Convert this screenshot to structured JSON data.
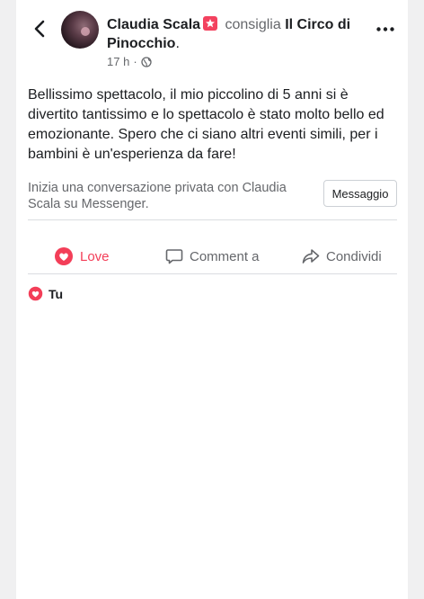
{
  "post": {
    "author": "Claudia Scala",
    "recommends_label": "consiglia",
    "page_name": "Il Circo di Pinocchio",
    "time": "17 h",
    "time_separator": "·",
    "body": "Bellissimo spettacolo, il mio piccolino di 5 anni si è divertito tantissimo e lo spettacolo è stato molto bello ed emozionante. Spero che ci siano altri eventi simili,  per i bambini è un'esperienza da fare!"
  },
  "messenger": {
    "prompt": "Inizia una conversazione privata con Claudia Scala su Messenger.",
    "button_label": "Messaggio"
  },
  "actions": {
    "love_label": "Love",
    "comment_label": "Comment a",
    "share_label": "Condividi"
  },
  "reactions": {
    "summary": "Tu"
  },
  "colors": {
    "love": "#f33e58",
    "secondary_text": "#65676b",
    "recommend_badge": "#f3425f"
  },
  "icons": {
    "back": "chevron-left-icon",
    "more": "more-horizontal-icon",
    "privacy": "globe-icon",
    "love": "love-reaction-icon",
    "comment": "comment-bubble-icon",
    "share": "share-arrow-icon",
    "recommend": "recommend-star-icon"
  }
}
